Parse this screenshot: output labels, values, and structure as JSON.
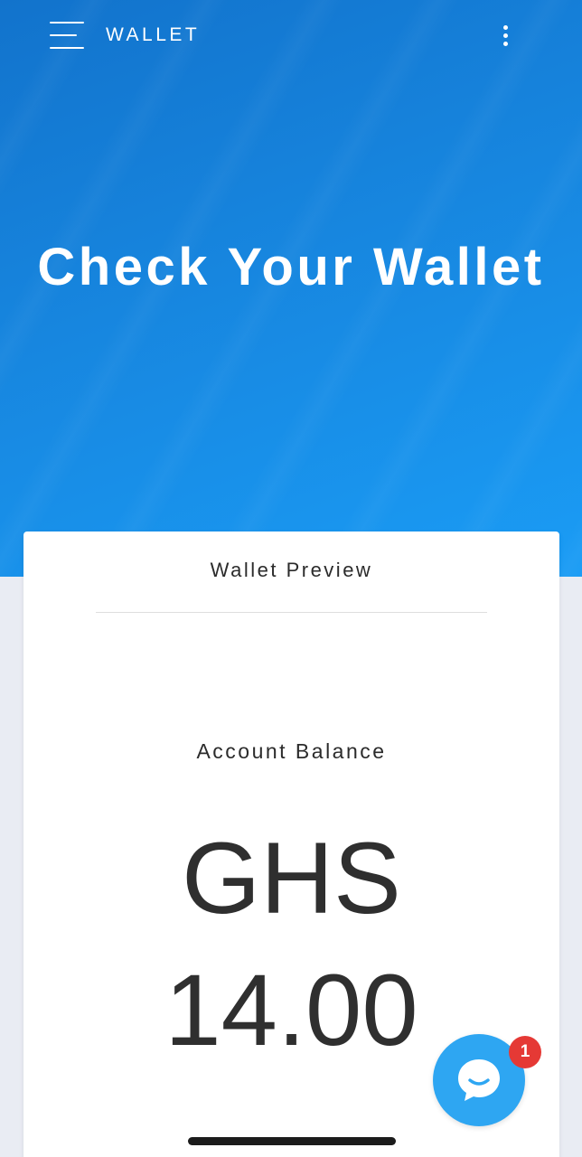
{
  "header": {
    "title": "WALLET",
    "menu_icon": "hamburger-menu-icon",
    "more_icon": "more-vertical-icon"
  },
  "hero": {
    "heading": "Check Your Wallet"
  },
  "card": {
    "title": "Wallet Preview",
    "balance_label": "Account Balance",
    "currency": "GHS",
    "amount": "14.00"
  },
  "chat": {
    "icon": "chat-bubble-icon",
    "badge_count": "1"
  },
  "colors": {
    "hero_start": "#1273cc",
    "hero_end": "#1a9cf5",
    "chat_button": "#2ea6f2",
    "badge": "#e53935",
    "background": "#e9ecf3"
  }
}
